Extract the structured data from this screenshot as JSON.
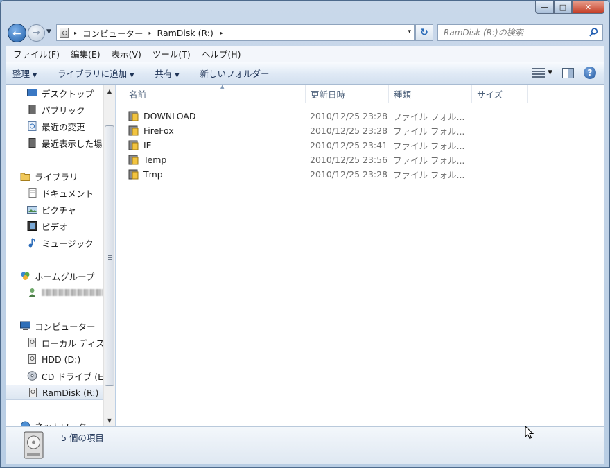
{
  "window": {
    "controls": {
      "minimize": "—",
      "maximize": "□",
      "close": "✕"
    }
  },
  "address_bar": {
    "crumbs": [
      "コンピューター",
      "RamDisk (R:)"
    ],
    "separator": "▸",
    "dropdown": "▾"
  },
  "search": {
    "placeholder": "RamDisk (R:)の検索"
  },
  "menu": {
    "items": [
      "ファイル(F)",
      "編集(E)",
      "表示(V)",
      "ツール(T)",
      "ヘルプ(H)"
    ]
  },
  "command_bar": {
    "organize": "整理",
    "add_to_library": "ライブラリに追加",
    "share": "共有",
    "new_folder": "新しいフォルダー",
    "help": "?"
  },
  "nav_pane": {
    "favorites": [
      "デスクトップ",
      "パブリック",
      "最近の変更",
      "最近表示した場所"
    ],
    "libraries": {
      "label": "ライブラリ",
      "items": [
        "ドキュメント",
        "ピクチャ",
        "ビデオ",
        "ミュージック"
      ]
    },
    "homegroup": {
      "label": "ホームグループ"
    },
    "computer": {
      "label": "コンピューター",
      "items": [
        "ローカル ディスク",
        "HDD (D:)",
        "CD ドライブ (E:",
        "RamDisk (R:)"
      ]
    },
    "network": {
      "label": "ネットワーク"
    }
  },
  "columns": {
    "name": "名前",
    "date": "更新日時",
    "type": "種類",
    "size": "サイズ"
  },
  "files": [
    {
      "name": "DOWNLOAD",
      "date": "2010/12/25 23:28",
      "type": "ファイル フォル..."
    },
    {
      "name": "FireFox",
      "date": "2010/12/25 23:28",
      "type": "ファイル フォル..."
    },
    {
      "name": "IE",
      "date": "2010/12/25 23:41",
      "type": "ファイル フォル..."
    },
    {
      "name": "Temp",
      "date": "2010/12/25 23:56",
      "type": "ファイル フォル..."
    },
    {
      "name": "Tmp",
      "date": "2010/12/25 23:28",
      "type": "ファイル フォル..."
    }
  ],
  "status": {
    "count_text": "5 個の項目"
  },
  "colors": {
    "accent": "#2a6bb8",
    "chrome": "#c9d8ea",
    "selected": "#dce6f1"
  }
}
